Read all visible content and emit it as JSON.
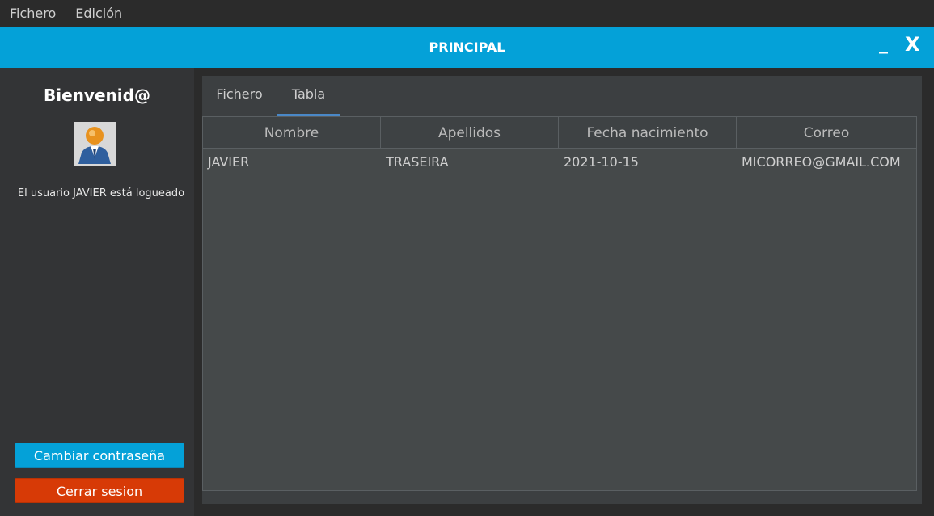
{
  "menubar": {
    "items": [
      "Fichero",
      "Edición"
    ]
  },
  "window": {
    "title": "PRINCIPAL",
    "minimize_label": "_",
    "close_label": "X",
    "accent_color": "#04a1d8"
  },
  "sidebar": {
    "welcome": "Bienvenid@",
    "avatar_icon": "user-avatar-icon",
    "status": "El usuario JAVIER está logueado",
    "change_password_label": "Cambiar contraseña",
    "logout_label": "Cerrar sesion",
    "logout_color": "#d73a06"
  },
  "tabs": [
    {
      "label": "Fichero",
      "active": false
    },
    {
      "label": "Tabla",
      "active": true
    }
  ],
  "table": {
    "columns": [
      "Nombre",
      "Apellidos",
      "Fecha nacimiento",
      "Correo"
    ],
    "rows": [
      [
        "JAVIER",
        "TRASEIRA",
        "2021-10-15",
        "MICORREO@GMAIL.COM"
      ]
    ]
  }
}
